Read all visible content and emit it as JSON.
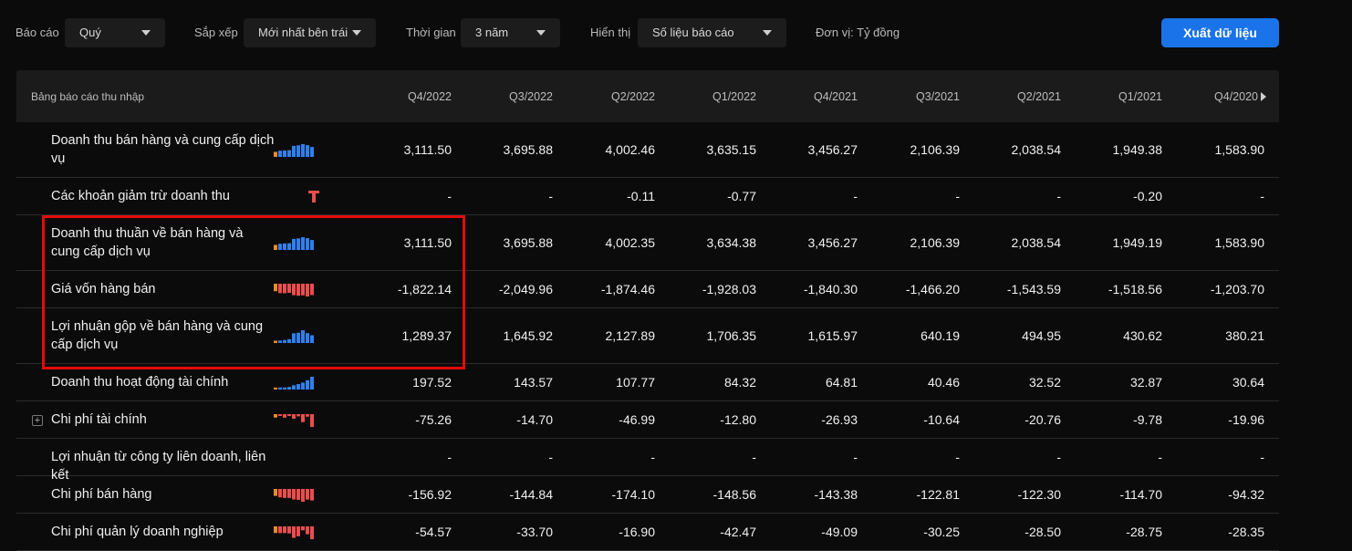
{
  "filters": {
    "report_label": "Báo cáo",
    "report_value": "Quý",
    "sort_label": "Sắp xếp",
    "sort_value": "Mới nhất bên trái",
    "time_label": "Thời gian",
    "time_value": "3 năm",
    "display_label": "Hiển thị",
    "display_value": "Số liệu báo cáo",
    "unit": "Đơn vị: Tỷ đồng",
    "export_label": "Xuất dữ liệu"
  },
  "table": {
    "title": "Bảng báo cáo thu nhập",
    "columns": [
      "Q4/2022",
      "Q3/2022",
      "Q2/2022",
      "Q1/2022",
      "Q4/2021",
      "Q3/2021",
      "Q2/2021",
      "Q1/2021",
      "Q4/2020"
    ],
    "rows": [
      {
        "label": "Doanh thu bán hàng và cung cấp dịch vụ",
        "values": [
          "3,111.50",
          "3,695.88",
          "4,002.46",
          "3,635.15",
          "3,456.27",
          "2,106.39",
          "2,038.54",
          "1,949.38",
          "1,583.90"
        ]
      },
      {
        "label": "Các khoản giảm trừ doanh thu",
        "values": [
          "-",
          "-",
          "-0.11",
          "-0.77",
          "-",
          "-",
          "-",
          "-0.20",
          "-"
        ]
      },
      {
        "label": "Doanh thu thuần về bán hàng và cung cấp dịch vụ",
        "values": [
          "3,111.50",
          "3,695.88",
          "4,002.35",
          "3,634.38",
          "3,456.27",
          "2,106.39",
          "2,038.54",
          "1,949.19",
          "1,583.90"
        ]
      },
      {
        "label": "Giá vốn hàng bán",
        "values": [
          "-1,822.14",
          "-2,049.96",
          "-1,874.46",
          "-1,928.03",
          "-1,840.30",
          "-1,466.20",
          "-1,543.59",
          "-1,518.56",
          "-1,203.70"
        ]
      },
      {
        "label": "Lợi nhuận gộp về bán hàng và cung cấp dịch vụ",
        "values": [
          "1,289.37",
          "1,645.92",
          "2,127.89",
          "1,706.35",
          "1,615.97",
          "640.19",
          "494.95",
          "430.62",
          "380.21"
        ]
      },
      {
        "label": "Doanh thu hoạt động tài chính",
        "values": [
          "197.52",
          "143.57",
          "107.77",
          "84.32",
          "64.81",
          "40.46",
          "32.52",
          "32.87",
          "30.64"
        ]
      },
      {
        "label": "Chi phí tài chính",
        "values": [
          "-75.26",
          "-14.70",
          "-46.99",
          "-12.80",
          "-26.93",
          "-10.64",
          "-20.76",
          "-9.78",
          "-19.96"
        ]
      },
      {
        "label": "Lợi nhuận từ công ty liên doanh, liên kết",
        "values": [
          "-",
          "-",
          "-",
          "-",
          "-",
          "-",
          "-",
          "-",
          "-"
        ]
      },
      {
        "label": "Chi phí bán hàng",
        "values": [
          "-156.92",
          "-144.84",
          "-174.10",
          "-148.56",
          "-143.38",
          "-122.81",
          "-122.30",
          "-114.70",
          "-94.32"
        ]
      },
      {
        "label": "Chi phí quản lý doanh nghiệp",
        "values": [
          "-54.57",
          "-33.70",
          "-16.90",
          "-42.47",
          "-49.09",
          "-30.25",
          "-28.50",
          "-28.75",
          "-28.35"
        ]
      }
    ]
  },
  "colors": {
    "accent_blue": "#1a73e8",
    "bar_blue": "#2f80ed",
    "bar_red": "#eb4d4d",
    "bar_orange": "#f08a24",
    "highlight_red": "#e30b0b"
  }
}
